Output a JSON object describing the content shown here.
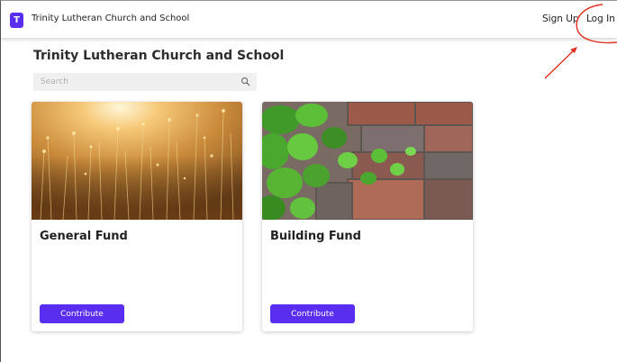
{
  "header": {
    "logo_letter": "T",
    "org_name": "Trinity Lutheran Church and School",
    "signup_label": "Sign Up",
    "login_label": "Log In"
  },
  "main": {
    "title": "Trinity Lutheran Church and School",
    "search": {
      "placeholder": "Search",
      "value": ""
    },
    "funds": [
      {
        "name": "General Fund",
        "button_label": "Contribute",
        "image": "golden grass field photo"
      },
      {
        "name": "Building Fund",
        "button_label": "Contribute",
        "image": "ivy on brick wall photo"
      }
    ]
  },
  "colors": {
    "accent": "#5a2ef0",
    "annotation": "#e0301e"
  }
}
